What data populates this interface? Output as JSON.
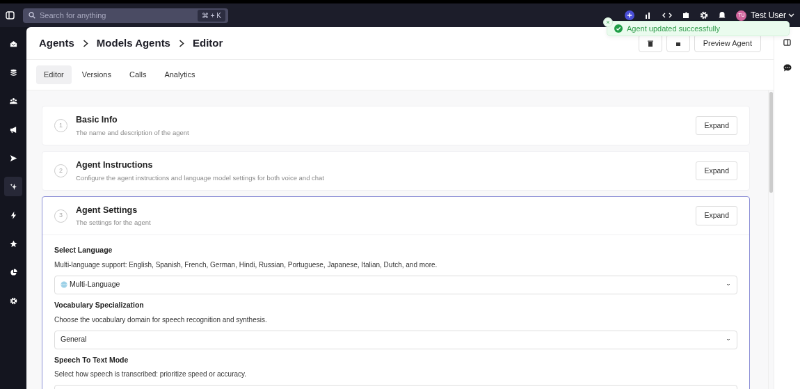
{
  "search": {
    "placeholder": "Search for anything",
    "shortcut": "⌘ + K"
  },
  "user": {
    "initials": "TU",
    "name": "Test User"
  },
  "toast": {
    "message": "Agent updated successfully",
    "close": "×"
  },
  "sidebar": {
    "items": [
      {
        "selected": false
      },
      {
        "selected": false
      },
      {
        "selected": false
      },
      {
        "selected": false
      },
      {
        "selected": false
      },
      {
        "selected": true
      },
      {
        "selected": false
      },
      {
        "selected": false
      },
      {
        "selected": false
      },
      {
        "selected": false
      }
    ]
  },
  "breadcrumb": [
    "Agents",
    "Models Agents",
    "Editor"
  ],
  "header_buttons": {
    "preview": "Preview Agent"
  },
  "tabs": [
    {
      "label": "Editor",
      "selected": true
    },
    {
      "label": "Versions",
      "selected": false
    },
    {
      "label": "Calls",
      "selected": false
    },
    {
      "label": "Analytics",
      "selected": false
    }
  ],
  "sections": [
    {
      "number": "1",
      "title": "Basic Info",
      "subtitle": "The name and description of the agent",
      "button": "Expand",
      "expanded": false
    },
    {
      "number": "2",
      "title": "Agent Instructions",
      "subtitle": "Configure the agent instructions and language model settings for both voice and chat",
      "button": "Expand",
      "expanded": false
    },
    {
      "number": "3",
      "title": "Agent Settings",
      "subtitle": "The settings for the agent",
      "button": "Expand",
      "expanded": true,
      "fields": [
        {
          "label": "Select Language",
          "help": "Multi-language support: English, Spanish, French, German, Hindi, Russian, Portuguese, Japanese, Italian, Dutch, and more.",
          "value": "Multi-Language",
          "kind": "language"
        },
        {
          "label": "Vocabulary Specialization",
          "help": "Choose the vocabulary domain for speech recognition and synthesis.",
          "value": "General",
          "kind": "select"
        },
        {
          "label": "Speech To Text Mode",
          "help": "Select how speech is transcribed: prioritize speed or accuracy.",
          "kind": "select"
        }
      ]
    }
  ]
}
